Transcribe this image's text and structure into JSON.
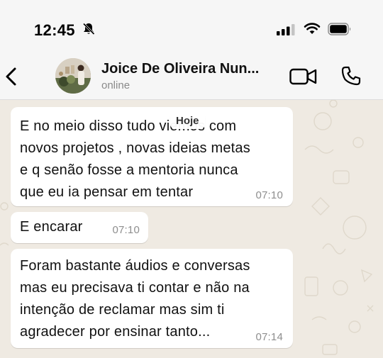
{
  "status_bar": {
    "time": "12:45"
  },
  "header": {
    "contact_name": "Joice De Oliveira Nun...",
    "contact_status": "online"
  },
  "date_divider": "Hoje",
  "messages": [
    {
      "text": "E no meio disso tudo viemos com\nnovos projetos , novas ideias metas\ne q senão fosse a mentoria nunca\nque eu ia pensar em tentar",
      "time": "07:10"
    },
    {
      "text": "E encarar",
      "time": "07:10"
    },
    {
      "text": "Foram bastante áudios e conversas\nmas eu precisava ti contar e não na\nintenção de reclamar mas sim ti\nagradecer por ensinar tanto...",
      "time": "07:14"
    }
  ],
  "colors": {
    "chat_background": "#efeae2",
    "bubble": "#ffffff",
    "header": "#f6f6f6"
  }
}
